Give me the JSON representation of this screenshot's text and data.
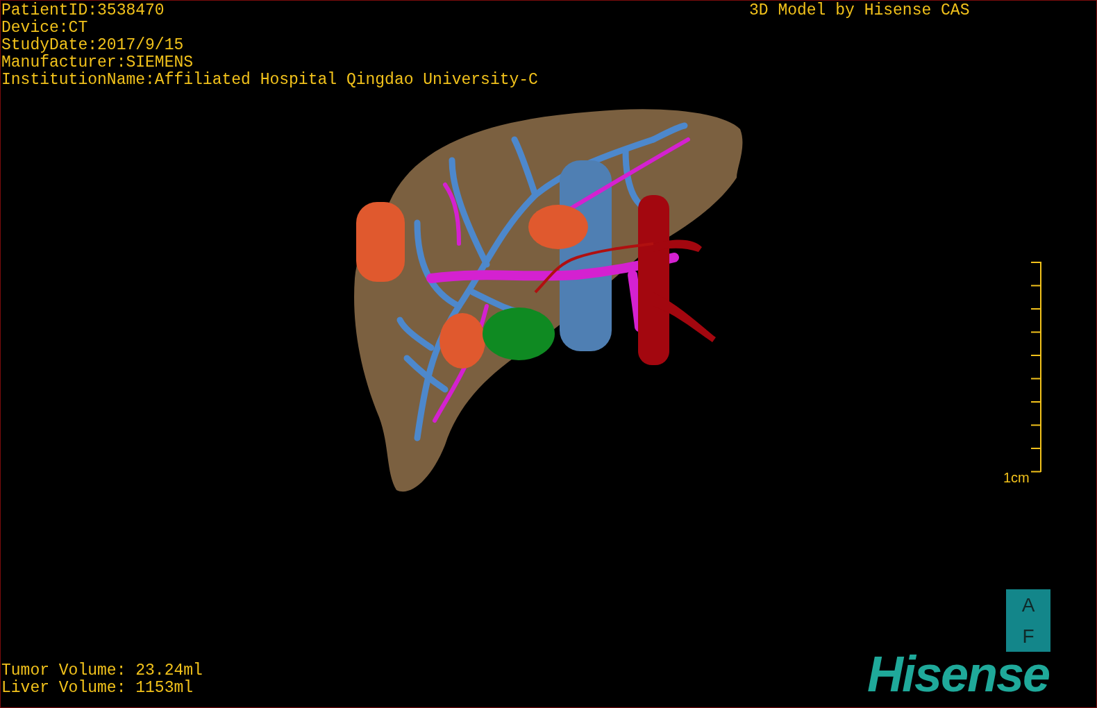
{
  "patient_info": [
    "PatientID:3538470",
    "Device:CT",
    "StudyDate:2017/9/15",
    "Manufacturer:SIEMENS",
    "InstitutionName:Affiliated Hospital Qingdao University-C"
  ],
  "credit": "3D Model by Hisense CAS",
  "scale_bar": {
    "label": "1cm"
  },
  "orientation": [
    "A",
    "F"
  ],
  "logo": "Hisense",
  "volumes": [
    "Tumor Volume: 23.24ml",
    "Liver Volume: 1153ml"
  ]
}
